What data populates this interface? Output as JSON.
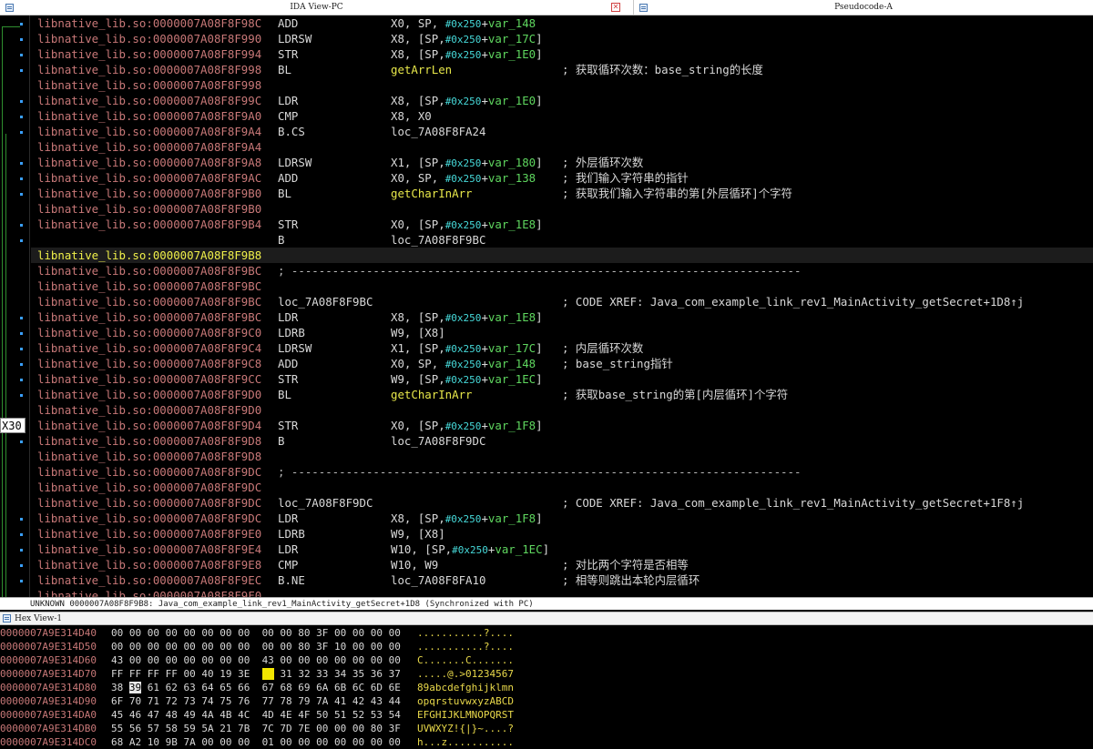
{
  "tabs": {
    "ida_view": "IDA View-PC",
    "pseudocode": "Pseudocode-A",
    "close_glyph": "✕"
  },
  "gutter": {
    "register_label": "X30"
  },
  "listing": [
    {
      "addr": "libnative_lib.so:0000007A08F8F98C",
      "mnem": "ADD",
      "ops": [
        [
          "p",
          "X0, SP, "
        ],
        [
          "h",
          "#0x250"
        ],
        [
          "p",
          "+"
        ],
        [
          "v",
          "var_148"
        ]
      ],
      "cmt": ""
    },
    {
      "addr": "libnative_lib.so:0000007A08F8F990",
      "mnem": "LDRSW",
      "ops": [
        [
          "p",
          "X8, [SP,"
        ],
        [
          "h",
          "#0x250"
        ],
        [
          "p",
          "+"
        ],
        [
          "v",
          "var_17C"
        ],
        [
          "p",
          "]"
        ]
      ],
      "cmt": ""
    },
    {
      "addr": "libnative_lib.so:0000007A08F8F994",
      "mnem": "STR",
      "ops": [
        [
          "p",
          "X8, [SP,"
        ],
        [
          "h",
          "#0x250"
        ],
        [
          "p",
          "+"
        ],
        [
          "v",
          "var_1E0"
        ],
        [
          "p",
          "]"
        ]
      ],
      "cmt": ""
    },
    {
      "addr": "libnative_lib.so:0000007A08F8F998",
      "mnem": "BL",
      "ops": [
        [
          "f",
          "getArrLen"
        ]
      ],
      "cmt": "; 获取循环次数：base_string的长度"
    },
    {
      "addr": "libnative_lib.so:0000007A08F8F998",
      "mnem": "",
      "ops": [],
      "cmt": ""
    },
    {
      "addr": "libnative_lib.so:0000007A08F8F99C",
      "mnem": "LDR",
      "ops": [
        [
          "p",
          "X8, [SP,"
        ],
        [
          "h",
          "#0x250"
        ],
        [
          "p",
          "+"
        ],
        [
          "v",
          "var_1E0"
        ],
        [
          "p",
          "]"
        ]
      ],
      "cmt": ""
    },
    {
      "addr": "libnative_lib.so:0000007A08F8F9A0",
      "mnem": "CMP",
      "ops": [
        [
          "p",
          "X8, X0"
        ]
      ],
      "cmt": ""
    },
    {
      "addr": "libnative_lib.so:0000007A08F8F9A4",
      "mnem": "B.CS",
      "ops": [
        [
          "p",
          "loc_7A08F8FA24"
        ]
      ],
      "cmt": ""
    },
    {
      "addr": "libnative_lib.so:0000007A08F8F9A4",
      "mnem": "",
      "ops": [],
      "cmt": ""
    },
    {
      "addr": "libnative_lib.so:0000007A08F8F9A8",
      "mnem": "LDRSW",
      "ops": [
        [
          "p",
          "X1, [SP,"
        ],
        [
          "h",
          "#0x250"
        ],
        [
          "p",
          "+"
        ],
        [
          "v",
          "var_180"
        ],
        [
          "p",
          "]"
        ]
      ],
      "cmt": "; 外层循环次数"
    },
    {
      "addr": "libnative_lib.so:0000007A08F8F9AC",
      "mnem": "ADD",
      "ops": [
        [
          "p",
          "X0, SP, "
        ],
        [
          "h",
          "#0x250"
        ],
        [
          "p",
          "+"
        ],
        [
          "v",
          "var_138"
        ]
      ],
      "cmt": "; 我们输入字符串的指针"
    },
    {
      "addr": "libnative_lib.so:0000007A08F8F9B0",
      "mnem": "BL",
      "ops": [
        [
          "f",
          "getCharInArr"
        ]
      ],
      "cmt": "; 获取我们输入字符串的第[外层循环]个字符"
    },
    {
      "addr": "libnative_lib.so:0000007A08F8F9B0",
      "mnem": "",
      "ops": [],
      "cmt": ""
    },
    {
      "addr": "libnative_lib.so:0000007A08F8F9B4",
      "mnem": "STR",
      "ops": [
        [
          "p",
          "X0, [SP,"
        ],
        [
          "h",
          "#0x250"
        ],
        [
          "p",
          "+"
        ],
        [
          "v",
          "var_1E8"
        ],
        [
          "p",
          "]"
        ]
      ],
      "cmt": ""
    },
    {
      "addr": "",
      "mnem": "B",
      "ops": [
        [
          "p",
          "loc_7A08F8F9BC"
        ]
      ],
      "cmt": ""
    },
    {
      "addr": "libnative_lib.so:0000007A08F8F9B8",
      "mnem": "",
      "ops": [],
      "cmt": "",
      "hl": true
    },
    {
      "addr": "libnative_lib.so:0000007A08F8F9BC",
      "sep": "; ---------------------------------------------------------------------------"
    },
    {
      "addr": "libnative_lib.so:0000007A08F8F9BC",
      "mnem": "",
      "ops": [],
      "cmt": ""
    },
    {
      "addr": "libnative_lib.so:0000007A08F8F9BC",
      "mnem": "loc_7A08F8F9BC",
      "ops": [],
      "cmt": "; CODE XREF: Java_com_example_link_rev1_MainActivity_getSecret+1D8↑j"
    },
    {
      "addr": "libnative_lib.so:0000007A08F8F9BC",
      "mnem": "LDR",
      "ops": [
        [
          "p",
          "X8, [SP,"
        ],
        [
          "h",
          "#0x250"
        ],
        [
          "p",
          "+"
        ],
        [
          "v",
          "var_1E8"
        ],
        [
          "p",
          "]"
        ]
      ],
      "cmt": ""
    },
    {
      "addr": "libnative_lib.so:0000007A08F8F9C0",
      "mnem": "LDRB",
      "ops": [
        [
          "p",
          "W9, [X8]"
        ]
      ],
      "cmt": ""
    },
    {
      "addr": "libnative_lib.so:0000007A08F8F9C4",
      "mnem": "LDRSW",
      "ops": [
        [
          "p",
          "X1, [SP,"
        ],
        [
          "h",
          "#0x250"
        ],
        [
          "p",
          "+"
        ],
        [
          "v",
          "var_17C"
        ],
        [
          "p",
          "]"
        ]
      ],
      "cmt": "; 内层循环次数"
    },
    {
      "addr": "libnative_lib.so:0000007A08F8F9C8",
      "mnem": "ADD",
      "ops": [
        [
          "p",
          "X0, SP, "
        ],
        [
          "h",
          "#0x250"
        ],
        [
          "p",
          "+"
        ],
        [
          "v",
          "var_148"
        ]
      ],
      "cmt": "; base_string指针"
    },
    {
      "addr": "libnative_lib.so:0000007A08F8F9CC",
      "mnem": "STR",
      "ops": [
        [
          "p",
          "W9, [SP,"
        ],
        [
          "h",
          "#0x250"
        ],
        [
          "p",
          "+"
        ],
        [
          "v",
          "var_1EC"
        ],
        [
          "p",
          "]"
        ]
      ],
      "cmt": ""
    },
    {
      "addr": "libnative_lib.so:0000007A08F8F9D0",
      "mnem": "BL",
      "ops": [
        [
          "f",
          "getCharInArr"
        ]
      ],
      "cmt": "; 获取base_string的第[内层循环]个字符"
    },
    {
      "addr": "libnative_lib.so:0000007A08F8F9D0",
      "mnem": "",
      "ops": [],
      "cmt": ""
    },
    {
      "addr": "libnative_lib.so:0000007A08F8F9D4",
      "mnem": "STR",
      "ops": [
        [
          "p",
          "X0, [SP,"
        ],
        [
          "h",
          "#0x250"
        ],
        [
          "p",
          "+"
        ],
        [
          "v",
          "var_1F8"
        ],
        [
          "p",
          "]"
        ]
      ],
      "cmt": ""
    },
    {
      "addr": "libnative_lib.so:0000007A08F8F9D8",
      "mnem": "B",
      "ops": [
        [
          "p",
          "loc_7A08F8F9DC"
        ]
      ],
      "cmt": ""
    },
    {
      "addr": "libnative_lib.so:0000007A08F8F9D8",
      "mnem": "",
      "ops": [],
      "cmt": ""
    },
    {
      "addr": "libnative_lib.so:0000007A08F8F9DC",
      "sep": "; ---------------------------------------------------------------------------"
    },
    {
      "addr": "libnative_lib.so:0000007A08F8F9DC",
      "mnem": "",
      "ops": [],
      "cmt": ""
    },
    {
      "addr": "libnative_lib.so:0000007A08F8F9DC",
      "mnem": "loc_7A08F8F9DC",
      "ops": [],
      "cmt": "; CODE XREF: Java_com_example_link_rev1_MainActivity_getSecret+1F8↑j"
    },
    {
      "addr": "libnative_lib.so:0000007A08F8F9DC",
      "mnem": "LDR",
      "ops": [
        [
          "p",
          "X8, [SP,"
        ],
        [
          "h",
          "#0x250"
        ],
        [
          "p",
          "+"
        ],
        [
          "v",
          "var_1F8"
        ],
        [
          "p",
          "]"
        ]
      ],
      "cmt": ""
    },
    {
      "addr": "libnative_lib.so:0000007A08F8F9E0",
      "mnem": "LDRB",
      "ops": [
        [
          "p",
          "W9, [X8]"
        ]
      ],
      "cmt": ""
    },
    {
      "addr": "libnative_lib.so:0000007A08F8F9E4",
      "mnem": "LDR",
      "ops": [
        [
          "p",
          "W10, [SP,"
        ],
        [
          "h",
          "#0x250"
        ],
        [
          "p",
          "+"
        ],
        [
          "v",
          "var_1EC"
        ],
        [
          "p",
          "]"
        ]
      ],
      "cmt": ""
    },
    {
      "addr": "libnative_lib.so:0000007A08F8F9E8",
      "mnem": "CMP",
      "ops": [
        [
          "p",
          "W10, W9"
        ]
      ],
      "cmt": "; 对比两个字符是否相等"
    },
    {
      "addr": "libnative_lib.so:0000007A08F8F9EC",
      "mnem": "B.NE",
      "ops": [
        [
          "p",
          "loc_7A08F8FA10"
        ]
      ],
      "cmt": "; 相等则跳出本轮内层循环"
    },
    {
      "addr": "libnative_lib.so:0000007A08F8F9F0",
      "mnem": "",
      "ops": [],
      "cmt": ""
    }
  ],
  "status": "UNKNOWN 0000007A08F8F9B8: Java_com_example_link_rev1_MainActivity_getSecret+1D8 (Synchronized with PC)",
  "hex_view": {
    "title": "Hex View-1",
    "rows": [
      {
        "addr": "0000007A9E314D40",
        "bytes": "00 00 00 00 00 00 00 00  00 00 80 3F 00 00 00 00",
        "ascii": "...........?...."
      },
      {
        "addr": "0000007A9E314D50",
        "bytes": "00 00 00 00 00 00 00 00  00 00 80 3F 10 00 00 00",
        "ascii": "...........?...."
      },
      {
        "addr": "0000007A9E314D60",
        "bytes": "43 00 00 00 00 00 00 00  43 00 00 00 00 00 00 00",
        "ascii": "C.......C......."
      },
      {
        "addr": "0000007A9E314D70",
        "bytes_pre": "FF FF FF FF 00 40 19 3E  ",
        "bytes_yel": "30",
        "bytes_post": " 31 32 33 34 35 36 37",
        "ascii": ".....@.>01234567"
      },
      {
        "addr": "0000007A9E314D80",
        "bytes_pre": "38 ",
        "bytes_cur": "39",
        "bytes_post": " 61 62 63 64 65 66  67 68 69 6A 6B 6C 6D 6E",
        "ascii": "89abcdefghijklmn"
      },
      {
        "addr": "0000007A9E314D90",
        "bytes": "6F 70 71 72 73 74 75 76  77 78 79 7A 41 42 43 44",
        "ascii": "opqrstuvwxyzABCD"
      },
      {
        "addr": "0000007A9E314DA0",
        "bytes": "45 46 47 48 49 4A 4B 4C  4D 4E 4F 50 51 52 53 54",
        "ascii": "EFGHIJKLMNOPQRST"
      },
      {
        "addr": "0000007A9E314DB0",
        "bytes": "55 56 57 58 59 5A 21 7B  7C 7D 7E 00 00 00 80 3F",
        "ascii": "UVWXYZ!{|}~....?"
      },
      {
        "addr": "0000007A9E314DC0",
        "bytes": "68 A2 10 9B 7A 00 00 00  01 00 00 00 00 00 00 00",
        "ascii": "h...z..........."
      }
    ]
  },
  "colors": {
    "address": "#c87878",
    "address_highlight": "#f0f04a",
    "immediate": "#46d9d9",
    "variable": "#5fd75f",
    "function": "#e8e84a",
    "ascii": "#e8d84a"
  }
}
